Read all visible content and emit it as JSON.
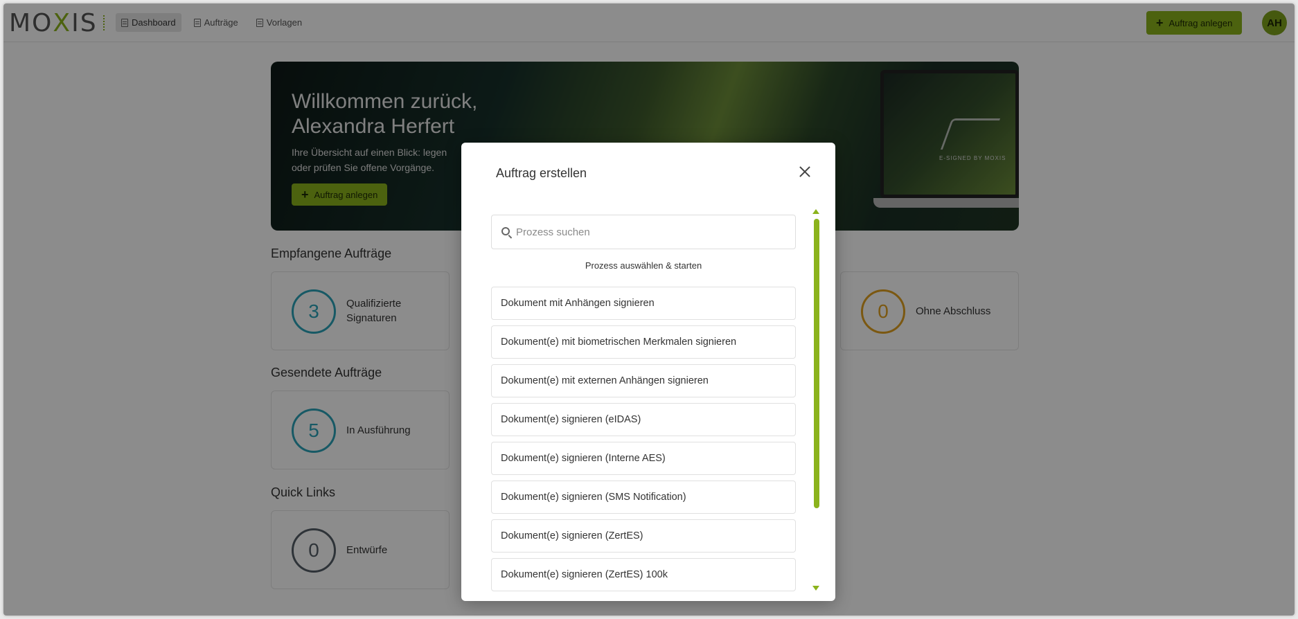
{
  "header": {
    "logo_text": "MOXIS",
    "nav": [
      {
        "label": "Dashboard",
        "active": true
      },
      {
        "label": "Aufträge",
        "active": false
      },
      {
        "label": "Vorlagen",
        "active": false
      }
    ],
    "create_button": "Auftrag anlegen",
    "avatar_initials": "AH"
  },
  "hero": {
    "title_line1": "Willkommen zurück,",
    "title_line2": "Alexandra Herfert",
    "subtitle_line1": "Ihre Übersicht auf einen Blick: legen",
    "subtitle_line2": "oder prüfen Sie offene Vorgänge.",
    "button": "Auftrag anlegen",
    "laptop_brand": "E-SIGNED BY MOXIS"
  },
  "sections": {
    "received": {
      "title": "Empfangene Aufträge",
      "cards": [
        {
          "count": "3",
          "label": "Qualifizierte Signaturen",
          "color": "#2aa3b8"
        },
        {
          "count": "0",
          "label": "Ohne Abschluss",
          "color": "#e0a020"
        }
      ]
    },
    "sent": {
      "title": "Gesendete Aufträge",
      "cards": [
        {
          "count": "5",
          "label": "In Ausführung",
          "color": "#2aa3b8"
        }
      ]
    },
    "quick": {
      "title": "Quick Links",
      "cards": [
        {
          "count": "0",
          "label": "Entwürfe",
          "color": "#555e66"
        }
      ]
    }
  },
  "modal": {
    "title": "Auftrag erstellen",
    "search_placeholder": "Prozess suchen",
    "hint": "Prozess auswählen & starten",
    "items": [
      "Dokument mit Anhängen signieren",
      "Dokument(e) mit biometrischen Merkmalen signieren",
      "Dokument(e) mit externen Anhängen signieren",
      "Dokument(e) signieren (eIDAS)",
      "Dokument(e) signieren (Interne AES)",
      "Dokument(e) signieren (SMS Notification)",
      "Dokument(e) signieren (ZertES)",
      "Dokument(e) signieren (ZertES) 100k"
    ]
  },
  "colors": {
    "accent": "#8bb31c",
    "teal": "#2aa3b8",
    "amber": "#e0a020"
  }
}
